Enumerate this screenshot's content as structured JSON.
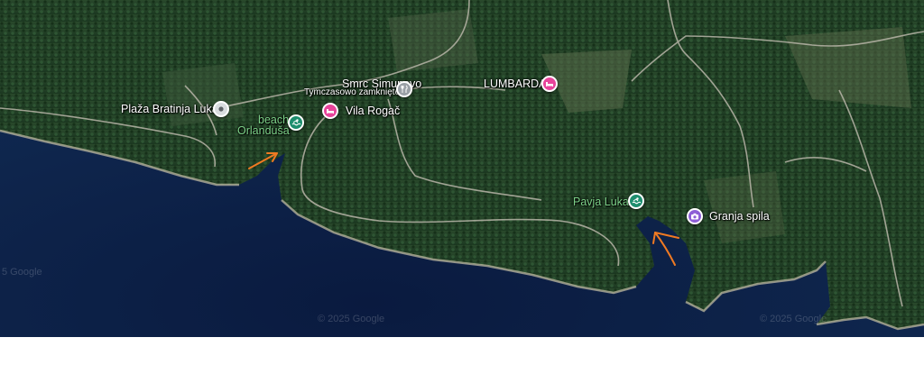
{
  "map": {
    "water_color": "#0b1f45",
    "forest_color": "#1f3d22",
    "road_color": "#b8b5a8",
    "arrow_color": "#f07a22",
    "places": {
      "plaza_bratinja_luka": {
        "label": "Plaža Bratinja Luka",
        "icon": "beach-pin-icon"
      },
      "beach_orlandusa": {
        "line1": "beach",
        "line2": "Orlanduša",
        "icon": "swim-pin-icon"
      },
      "vila_rogac": {
        "label": "Vila Rogač",
        "icon": "hotel-pin-icon"
      },
      "smrc_simunovo": {
        "line1": "Smrc Simunovo",
        "line2": "Tymczasowo zamknięte",
        "icon": "restaurant-pin-icon"
      },
      "lumbarda": {
        "label": "LUMBARDA",
        "icon": "hotel-pin-icon"
      },
      "pavja_luka": {
        "label": "Pavja Luka",
        "icon": "swim-pin-icon"
      },
      "granja_spila": {
        "label": "Granja spila",
        "icon": "camera-pin-icon"
      }
    },
    "watermarks": {
      "left": "5 Google",
      "center": "© 2025 Google",
      "right": "© 2025 Google"
    }
  }
}
